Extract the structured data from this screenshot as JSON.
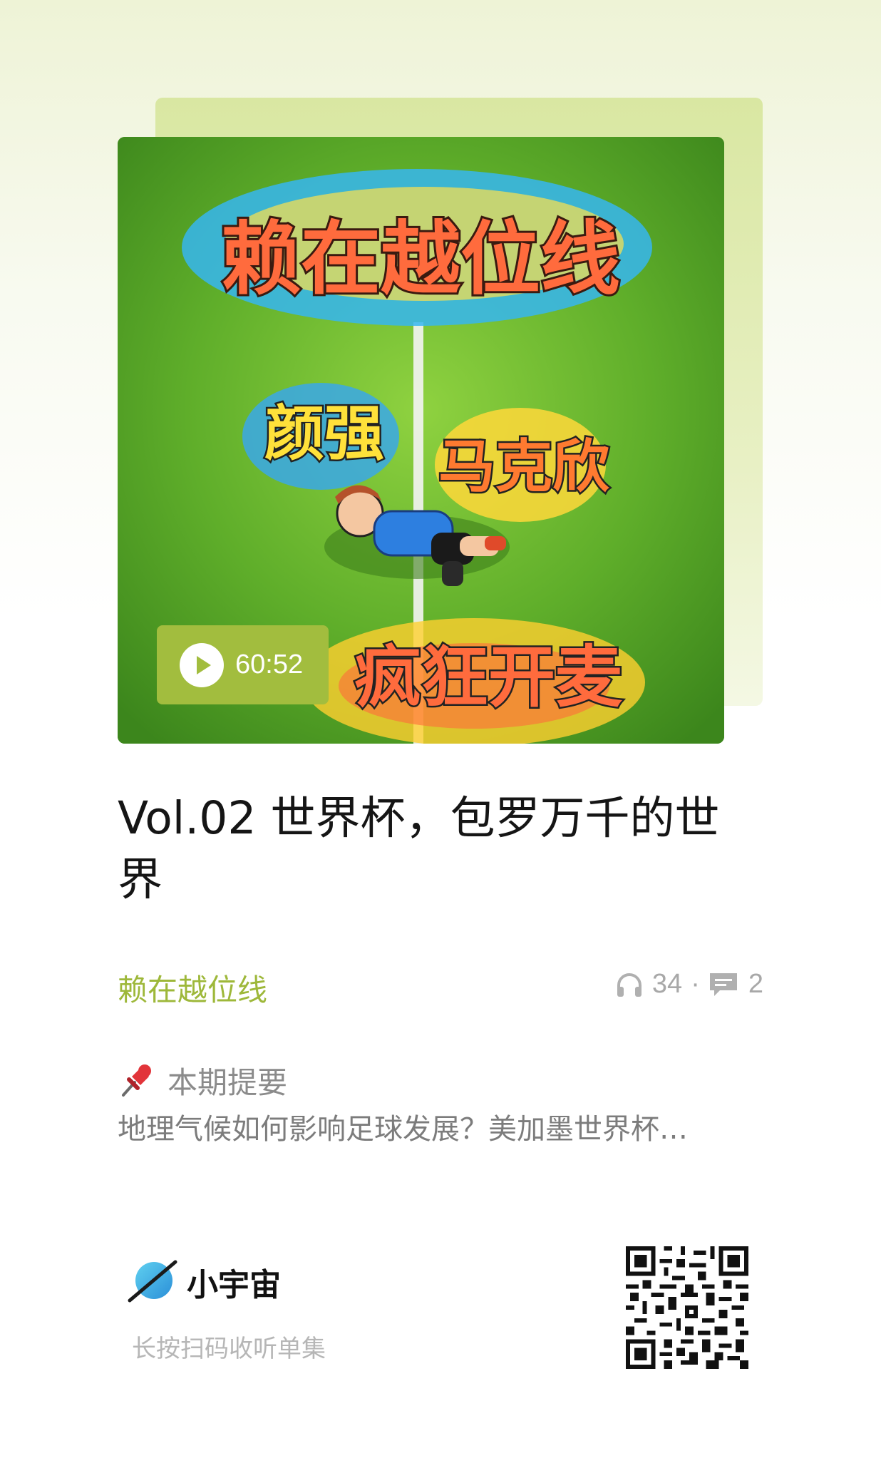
{
  "cover": {
    "title_art": "赖在越位线",
    "names": [
      "颜强",
      "马克欣"
    ],
    "tagline": "疯狂开麦",
    "duration": "60:52"
  },
  "episode": {
    "title": "Vol.02 世界杯，包罗万千的世界"
  },
  "show": {
    "name": "赖在越位线"
  },
  "stats": {
    "plays": "34",
    "separator": "·",
    "comments": "2"
  },
  "summary": {
    "heading": "本期提要",
    "text": "地理气候如何影响足球发展？美加墨世界杯…"
  },
  "brand": {
    "name": "小宇宙",
    "scan_tip": "长按扫码收听单集"
  },
  "colors": {
    "accent": "#9eb83a",
    "pill": "#a2bd3e",
    "title": "#151515"
  }
}
